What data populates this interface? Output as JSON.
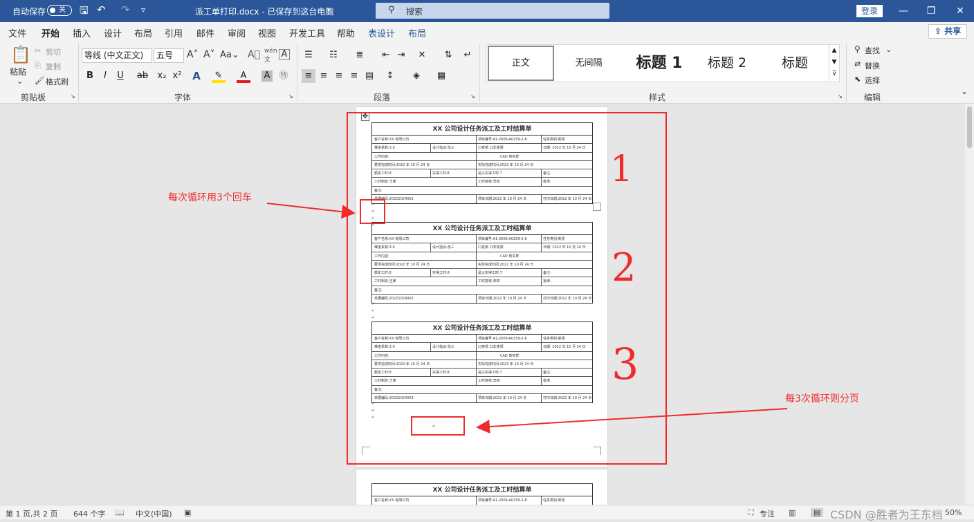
{
  "titlebar": {
    "autosave_label": "自动保存",
    "autosave_state": "关",
    "doc_title": "派工单打印.docx - 已保存到这台电脑",
    "search_placeholder": "搜索",
    "login": "登录"
  },
  "tabs": [
    "文件",
    "开始",
    "插入",
    "设计",
    "布局",
    "引用",
    "邮件",
    "审阅",
    "视图",
    "开发工具",
    "帮助",
    "表设计",
    "布局"
  ],
  "share": "共享",
  "ribbon": {
    "clipboard": {
      "paste": "粘贴",
      "cut": "剪切",
      "copy": "复制",
      "format_painter": "格式刷",
      "label": "剪贴板"
    },
    "font": {
      "name": "等线 (中文正文)",
      "size": "五号",
      "label": "字体"
    },
    "paragraph": {
      "label": "段落"
    },
    "styles": {
      "items": [
        "正文",
        "无间隔",
        "标题 1",
        "标题 2",
        "标题"
      ],
      "label": "样式"
    },
    "editing": {
      "find": "查找",
      "replace": "替换",
      "select": "选择",
      "label": "编辑"
    }
  },
  "document": {
    "form_title": "XX 公司设计任务派工及工时结算单",
    "rows": [
      [
        "客户名称:XX 有限公司",
        "项目编号:A1-2006-A0259-2-8",
        "任务类别:新契"
      ],
      [
        "难度系数:3.0",
        "设计指派:张三",
        "口变频 口非变频",
        "日期: 2022 年 10 月 24 日"
      ],
      [
        "工作内容:",
        "CAD 到实样"
      ],
      [
        "要求完成时间:2022 年 10 月 24 日",
        "实际完成时间:2022 年 10 月 24 日"
      ],
      [
        "额定工时:8",
        "实得工时:8",
        "是以实得工时:7",
        "备注:"
      ],
      [
        "工时制定:王某",
        "工时复核:李四",
        "批准:"
      ],
      [
        "备注:"
      ],
      [
        "单据编码:20221024001",
        "项目日期:2022 年 10 月 24 日",
        "打印日期:2022 年 10 月 24 日"
      ]
    ],
    "page2_rows": [
      [
        "客户名称:XX 有限公司",
        "项目编号:A1-2006-A0259-2-8",
        "任务类别:新契"
      ]
    ],
    "codes": [
      "20221024001",
      "20221024002",
      "20221024003"
    ]
  },
  "annotations": {
    "left": "每次循环用3个回车",
    "right": "每3次循环则分页",
    "numbers": [
      "1",
      "2",
      "3"
    ]
  },
  "statusbar": {
    "page": "第 1 页,共 2 页",
    "words": "644 个字",
    "lang": "中文(中国)",
    "focus": "专注",
    "zoom": "50%",
    "watermark": "CSDN @胜者为王东档"
  },
  "colors": {
    "brand": "#2b579a",
    "annotation": "#ef2b2b"
  }
}
